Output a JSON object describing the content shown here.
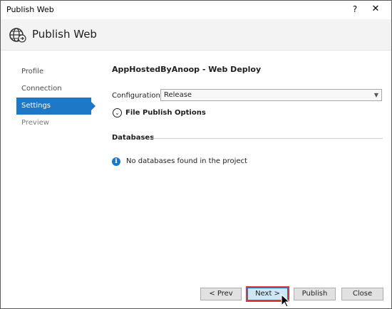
{
  "window": {
    "title": "Publish Web",
    "help_glyph": "?",
    "close_glyph": "✕"
  },
  "header": {
    "title": "Publish Web"
  },
  "sidebar": {
    "items": [
      {
        "label": "Profile"
      },
      {
        "label": "Connection"
      },
      {
        "label": "Settings",
        "state": "selected"
      },
      {
        "label": "Preview",
        "state": "disabled"
      }
    ]
  },
  "content": {
    "title": "AppHostedByAnoop - Web Deploy",
    "configuration_label": "Configuration:",
    "configuration_value": "Release",
    "file_publish_options_label": "File Publish Options",
    "databases_heading": "Databases",
    "databases_message": "No databases found in the project"
  },
  "buttons": {
    "prev": "< Prev",
    "next": "Next >",
    "publish": "Publish",
    "close": "Close"
  },
  "colors": {
    "accent": "#1e78c8",
    "highlight": "#d83b3b"
  }
}
